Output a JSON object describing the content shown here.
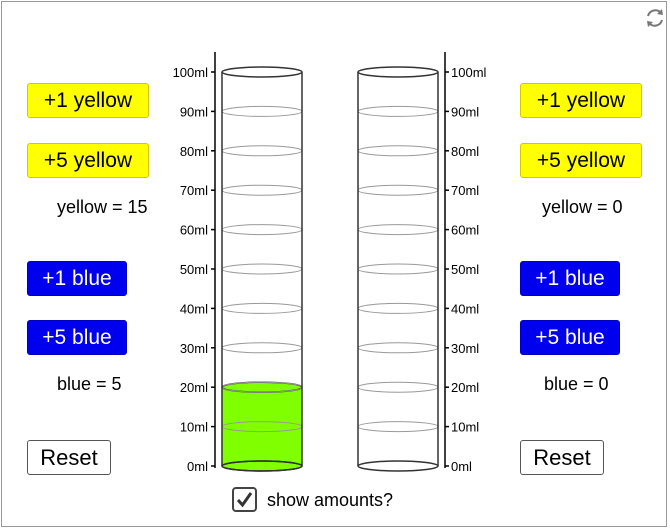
{
  "left": {
    "plus1_yellow": "+1 yellow",
    "plus5_yellow": "+5 yellow",
    "yellow_readout": "yellow = 15",
    "plus1_blue": "+1 blue",
    "plus5_blue": "+5 blue",
    "blue_readout": "blue = 5",
    "reset": "Reset",
    "fill_ml": 20,
    "fill_color": "#80ff00"
  },
  "right": {
    "plus1_yellow": "+1 yellow",
    "plus5_yellow": "+5 yellow",
    "yellow_readout": "yellow = 0",
    "plus1_blue": "+1 blue",
    "plus5_blue": "+5 blue",
    "blue_readout": "blue = 0",
    "reset": "Reset",
    "fill_ml": 0
  },
  "scale_labels": [
    "0ml",
    "10ml",
    "20ml",
    "30ml",
    "40ml",
    "50ml",
    "60ml",
    "70ml",
    "80ml",
    "90ml",
    "100ml"
  ],
  "show_amounts": {
    "label": "show amounts?",
    "checked": true
  },
  "icons": {
    "refresh": "refresh-icon",
    "checkmark": "checkmark-icon"
  },
  "colors": {
    "yellow": "#ffff00",
    "blue": "#0000ee",
    "mixture": "#80ff00"
  }
}
